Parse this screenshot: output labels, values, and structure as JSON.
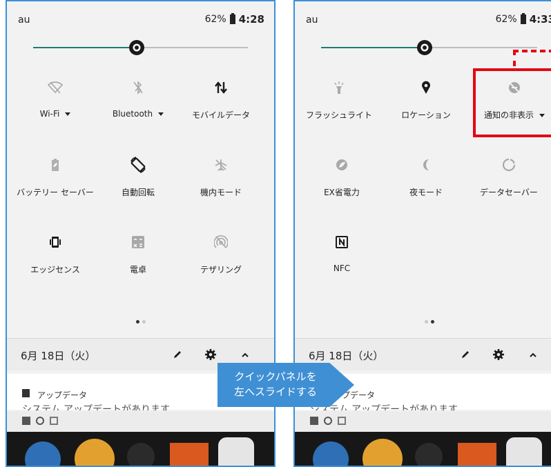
{
  "left_screen": {
    "status": {
      "carrier": "au",
      "battery": "62%",
      "time": "4:28"
    },
    "brightness_level": 0.48,
    "tiles": [
      {
        "label": "Wi-Fi",
        "icon": "wifi-off-icon",
        "dropdown": true
      },
      {
        "label": "Bluetooth",
        "icon": "bluetooth-off-icon",
        "dropdown": true
      },
      {
        "label": "モバイルデータ",
        "icon": "mobile-data-icon",
        "dropdown": false
      },
      {
        "label": "バッテリー セーバー",
        "icon": "battery-saver-icon",
        "dropdown": false
      },
      {
        "label": "自動回転",
        "icon": "auto-rotate-icon",
        "dropdown": false
      },
      {
        "label": "機内モード",
        "icon": "airplane-mode-icon",
        "dropdown": false
      },
      {
        "label": "エッジセンス",
        "icon": "edge-sense-icon",
        "dropdown": false
      },
      {
        "label": "電卓",
        "icon": "calculator-icon",
        "dropdown": false
      },
      {
        "label": "テザリング",
        "icon": "tethering-icon",
        "dropdown": false
      }
    ],
    "page_indicator": {
      "pages": 2,
      "current": 1
    },
    "date": "6月 18日（火）",
    "notification": {
      "title": "アップデータ",
      "text": "システム アップデートがあります"
    }
  },
  "right_screen": {
    "status": {
      "carrier": "au",
      "battery": "62%",
      "time": "4:33"
    },
    "brightness_level": 0.48,
    "tiles": [
      {
        "label": "フラッシュライト",
        "icon": "flashlight-icon",
        "dropdown": false
      },
      {
        "label": "ロケーション",
        "icon": "location-icon",
        "dropdown": false
      },
      {
        "label": "通知の非表示",
        "icon": "do-not-disturb-icon",
        "dropdown": true
      },
      {
        "label": "EX省電力",
        "icon": "ex-power-saving-icon",
        "dropdown": false
      },
      {
        "label": "夜モード",
        "icon": "night-mode-icon",
        "dropdown": false
      },
      {
        "label": "データセーバー",
        "icon": "data-saver-icon",
        "dropdown": false
      },
      {
        "label": "NFC",
        "icon": "nfc-icon",
        "dropdown": false
      }
    ],
    "page_indicator": {
      "pages": 2,
      "current": 2
    },
    "date": "6月 18日（火）",
    "notification": {
      "title": "アップデータ",
      "text": "システム アップデートがあります"
    }
  },
  "callout": {
    "line1": "クイックパネルを",
    "line2": "左へスライドする"
  },
  "colors": {
    "accent": "#1e7a75",
    "highlight": "#e30613",
    "callout": "#3f8fd4",
    "frame": "#3c8fd6"
  }
}
